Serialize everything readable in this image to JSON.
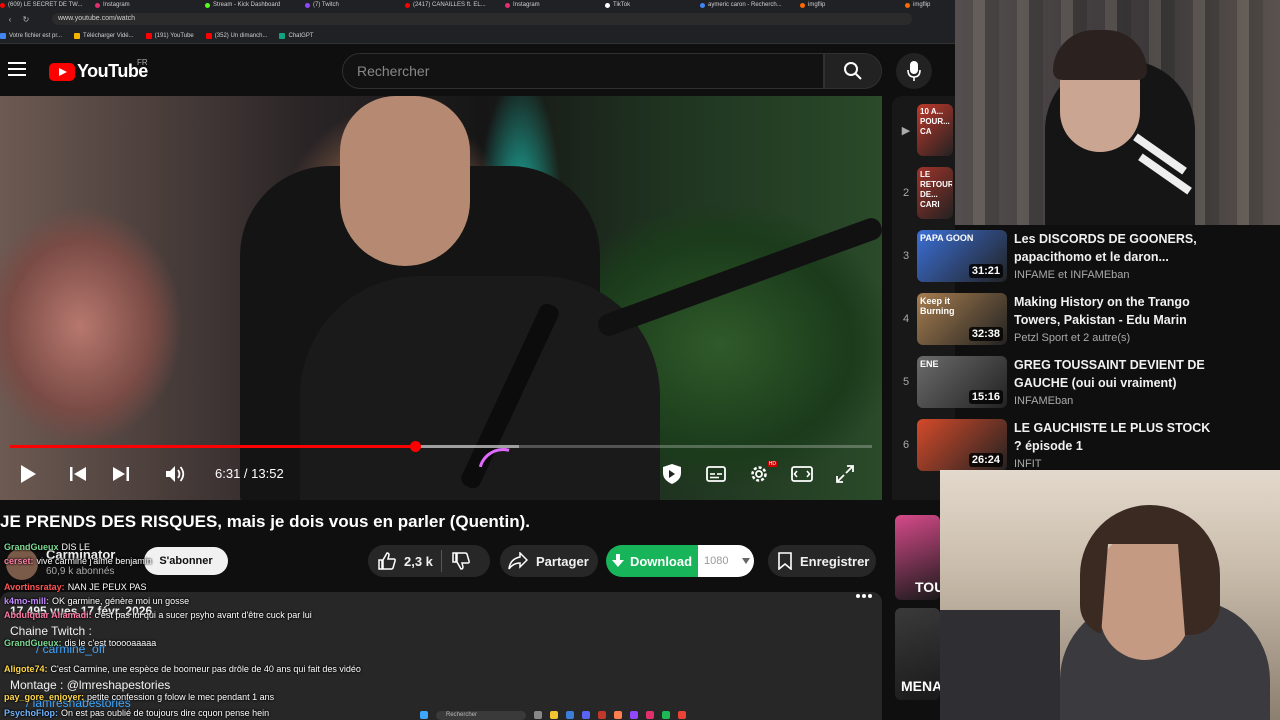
{
  "browser": {
    "tabs": [
      {
        "label": "(609) LE SECRET DE TW...",
        "color": "#ff0000"
      },
      {
        "label": "Instagram",
        "color": "#e1306c"
      },
      {
        "label": "Stream - Kick Dashboard",
        "color": "#53fc18"
      },
      {
        "label": "(7) Twitch",
        "color": "#9146ff"
      },
      {
        "label": "(2417) CANAILLES ft. EL...",
        "color": "#ff0000"
      },
      {
        "label": "Instagram",
        "color": "#e1306c"
      },
      {
        "label": "TikTok",
        "color": "#ffffff"
      },
      {
        "label": "aymeric caron - Recherch...",
        "color": "#4285f4"
      },
      {
        "label": "imgflip",
        "color": "#ff6a00"
      },
      {
        "label": "imgflip",
        "color": "#ff6a00"
      }
    ],
    "url": "www.youtube.com/watch",
    "bookmarks": [
      {
        "label": "Votre fichier est pr...",
        "color": "#4285f4"
      },
      {
        "label": "Télécharger Vidé...",
        "color": "#f4b400"
      },
      {
        "label": "(191) YouTube",
        "color": "#ff0000"
      },
      {
        "label": "(352) Un dimanch...",
        "color": "#ff0000"
      },
      {
        "label": "ChatGPT",
        "color": "#10a37f"
      }
    ]
  },
  "header": {
    "logo_text": "YouTube",
    "country": "FR",
    "search_placeholder": "Rechercher"
  },
  "player": {
    "current_time": "6:31",
    "duration": "13:52",
    "time_display": "6:31 / 13:52",
    "progress_fraction": 0.47,
    "buffered_fraction": 0.59,
    "hd_badge": "HD"
  },
  "video": {
    "title": "JE PRENDS DES RISQUES, mais je dois vous en parler (Quentin).",
    "channel": "Carminator",
    "subscribers": "60,9 k abonnés",
    "subscribe_label": "S'abonner",
    "likes": "2,3 k",
    "share_label": "Partager",
    "download_label": "Download",
    "quality": "1080",
    "save_label": "Enregistrer"
  },
  "description": {
    "meta": "17 495 vues  17 févr. 2026",
    "line1": "Chaine Twitch :",
    "line2": "/ carmine_off",
    "line3": "Montage : @lmreshapestories",
    "line4": "/ lamreshabestories"
  },
  "chat": [
    {
      "user": "GrandGueux",
      "color": "#7cd992",
      "text": "DIS LE"
    },
    {
      "user": "cerset:",
      "color": "#ff7aa8",
      "text": "vive carmine j'aime benjamin"
    },
    {
      "user": "Avortinsratay:",
      "color": "#ff5555",
      "text": "NAN JE PEUX PAS"
    },
    {
      "user": "k4mo-mill:",
      "color": "#c38bff",
      "text": "OK garmine, génère moi un gosse"
    },
    {
      "user": "Abdulquar Aliamadi:",
      "color": "#ff7aa8",
      "text": "c'est pas lui qui a sucer psyho avant d'être cuck par lui"
    },
    {
      "user": "GrandGueux:",
      "color": "#7cd992",
      "text": "dis le c'est tooooaaaaa"
    },
    {
      "user": "Aligote74:",
      "color": "#ffd84a",
      "text": "C'est Carmine, une espèce de boomeur pas drôle de 40 ans qui fait des vidéo"
    },
    {
      "user": "pay_gore_enjoyer:",
      "color": "#ffd84a",
      "text": "petite confession g folow le mec pendant 1 ans"
    },
    {
      "user": "PsychoFlop:",
      "color": "#6fb3ff",
      "text": "On est pas oublié de toujours dire cquon pense hein"
    }
  ],
  "playlist": [
    {
      "index": "▶",
      "thumb_text": "10 A... POUR... CA",
      "duration": "",
      "title": "",
      "channel": "",
      "color": "#c0392b"
    },
    {
      "index": "2",
      "thumb_text": "LE RETOUR DE... CARI",
      "duration": "",
      "title": "",
      "channel": "",
      "color": "#a0332a"
    },
    {
      "index": "3",
      "thumb_text": "PAPA GOON",
      "duration": "31:21",
      "title": "Les DISCORDS DE GOONERS, papacithomo et le daron...",
      "channel": "INFAME et INFAMEban",
      "color": "#3b6fd6"
    },
    {
      "index": "4",
      "thumb_text": "Keep it Burning",
      "duration": "32:38",
      "title": "Making History on the Trango Towers, Pakistan - Edu Marin",
      "channel": "Petzl Sport et 2 autre(s)",
      "color": "#a67d4f"
    },
    {
      "index": "5",
      "thumb_text": "ENE",
      "duration": "15:16",
      "title": "GREG TOUSSAINT DEVIENT DE GAUCHE (oui oui vraiment)",
      "channel": "INFAMEban",
      "color": "#6b6b6b"
    },
    {
      "index": "6",
      "thumb_text": "",
      "duration": "26:24",
      "title": "LE GAUCHISTE LE PLUS STOCK ? épisode 1",
      "channel": "INFIT",
      "color": "#d44a2a"
    }
  ],
  "side_thumbs": [
    {
      "text": "TOU",
      "color": "#d64a8a"
    },
    {
      "text": "MENA",
      "color": "#3a3a3a"
    }
  ],
  "taskbar": {
    "search_placeholder": "Rechercher"
  },
  "colors": {
    "yt_red": "#ff0000",
    "download_green": "#18b45a",
    "background": "#0f0f0f",
    "pill": "#272727"
  }
}
